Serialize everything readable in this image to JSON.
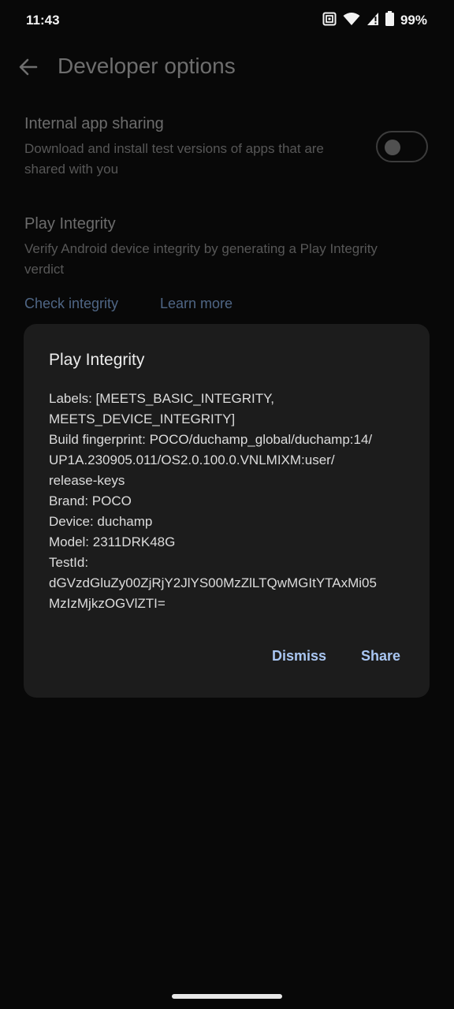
{
  "status_bar": {
    "time": "11:43",
    "battery": "99%",
    "icons": [
      "nfc-icon",
      "wifi-icon",
      "signal-icon",
      "battery-icon"
    ]
  },
  "app_bar": {
    "title": "Developer options",
    "back_icon": "arrow-left-icon"
  },
  "internal_app_sharing": {
    "title": "Internal app sharing",
    "description_lines": [
      "Download and install test versions of apps that are",
      "shared with you"
    ],
    "toggle_state": "off"
  },
  "play_integrity": {
    "title": "Play Integrity",
    "description_lines": [
      "Verify Android device integrity by generating a Play Integrity",
      "verdict"
    ],
    "check_label": "Check integrity",
    "learn_label": "Learn more"
  },
  "dialog": {
    "title": "Play Integrity",
    "lines": [
      "Labels: [MEETS_BASIC_INTEGRITY,",
      "MEETS_DEVICE_INTEGRITY]",
      "Build fingerprint: POCO/duchamp_global/duchamp:14/",
      "UP1A.230905.011/OS2.0.100.0.VNLMIXM:user/",
      "release-keys",
      "Brand: POCO",
      "Device: duchamp",
      "Model: 2311DRK48G",
      "TestId:",
      "dGVzdGluZy00ZjRjY2JlYS00MzZlLTQwMGItYTAxMi05",
      "MzIzMjkzOGVlZTI="
    ],
    "dismiss_label": "Dismiss",
    "share_label": "Share"
  },
  "colors": {
    "background": "#080808",
    "dialog": "#1c1c1c",
    "accent": "#a9c6f2",
    "dim_link": "#4f6685"
  }
}
